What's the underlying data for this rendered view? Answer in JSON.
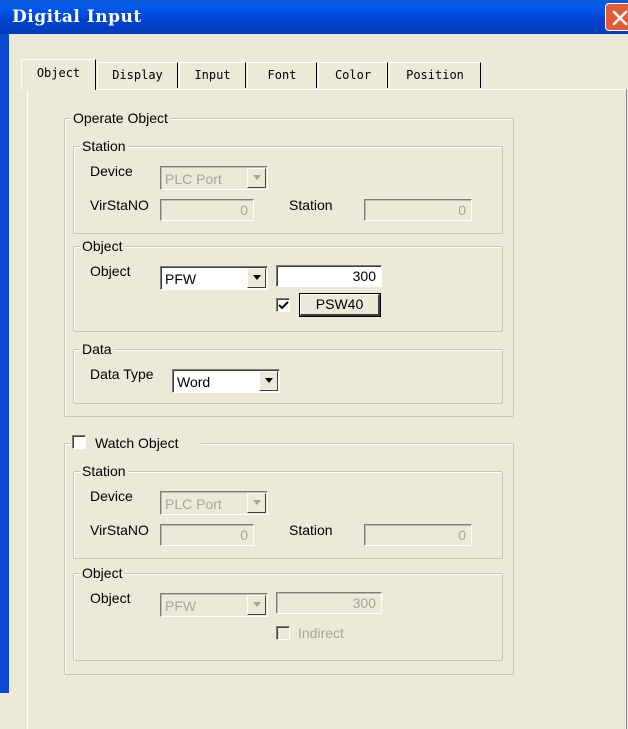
{
  "window": {
    "title": "Digital Input"
  },
  "tabs": [
    {
      "label": "Object",
      "active": true
    },
    {
      "label": "Display",
      "active": false
    },
    {
      "label": "Input",
      "active": false
    },
    {
      "label": "Font",
      "active": false
    },
    {
      "label": "Color",
      "active": false
    },
    {
      "label": "Position",
      "active": false
    }
  ],
  "operate": {
    "legend": "Operate Object",
    "station": {
      "legend": "Station",
      "device_label": "Device",
      "device_value": "PLC Port",
      "virsta_label": "VirStaNO",
      "virsta_value": "0",
      "station_label": "Station",
      "station_value": "0"
    },
    "object": {
      "legend": "Object",
      "object_label": "Object",
      "object_type": "PFW",
      "object_address": "300",
      "indirect_checked": true,
      "indirect_button": "PSW40"
    },
    "data": {
      "legend": "Data",
      "type_label": "Data Type",
      "type_value": "Word"
    }
  },
  "watch": {
    "legend": "Watch Object",
    "checked": false,
    "station": {
      "legend": "Station",
      "device_label": "Device",
      "device_value": "PLC Port",
      "virsta_label": "VirStaNO",
      "virsta_value": "0",
      "station_label": "Station",
      "station_value": "0"
    },
    "object": {
      "legend": "Object",
      "object_label": "Object",
      "object_type": "PFW",
      "object_address": "300",
      "indirect_label": "Indirect",
      "indirect_checked": false
    }
  },
  "icons": {
    "close": "close-icon",
    "dropdown": "chevron-down-icon",
    "check": "checkmark-icon"
  },
  "colors": {
    "titlebar": "#0058ee",
    "close_button": "#e25b37",
    "dialog_bg": "#ece9d8",
    "disabled_text": "#a8a597"
  }
}
